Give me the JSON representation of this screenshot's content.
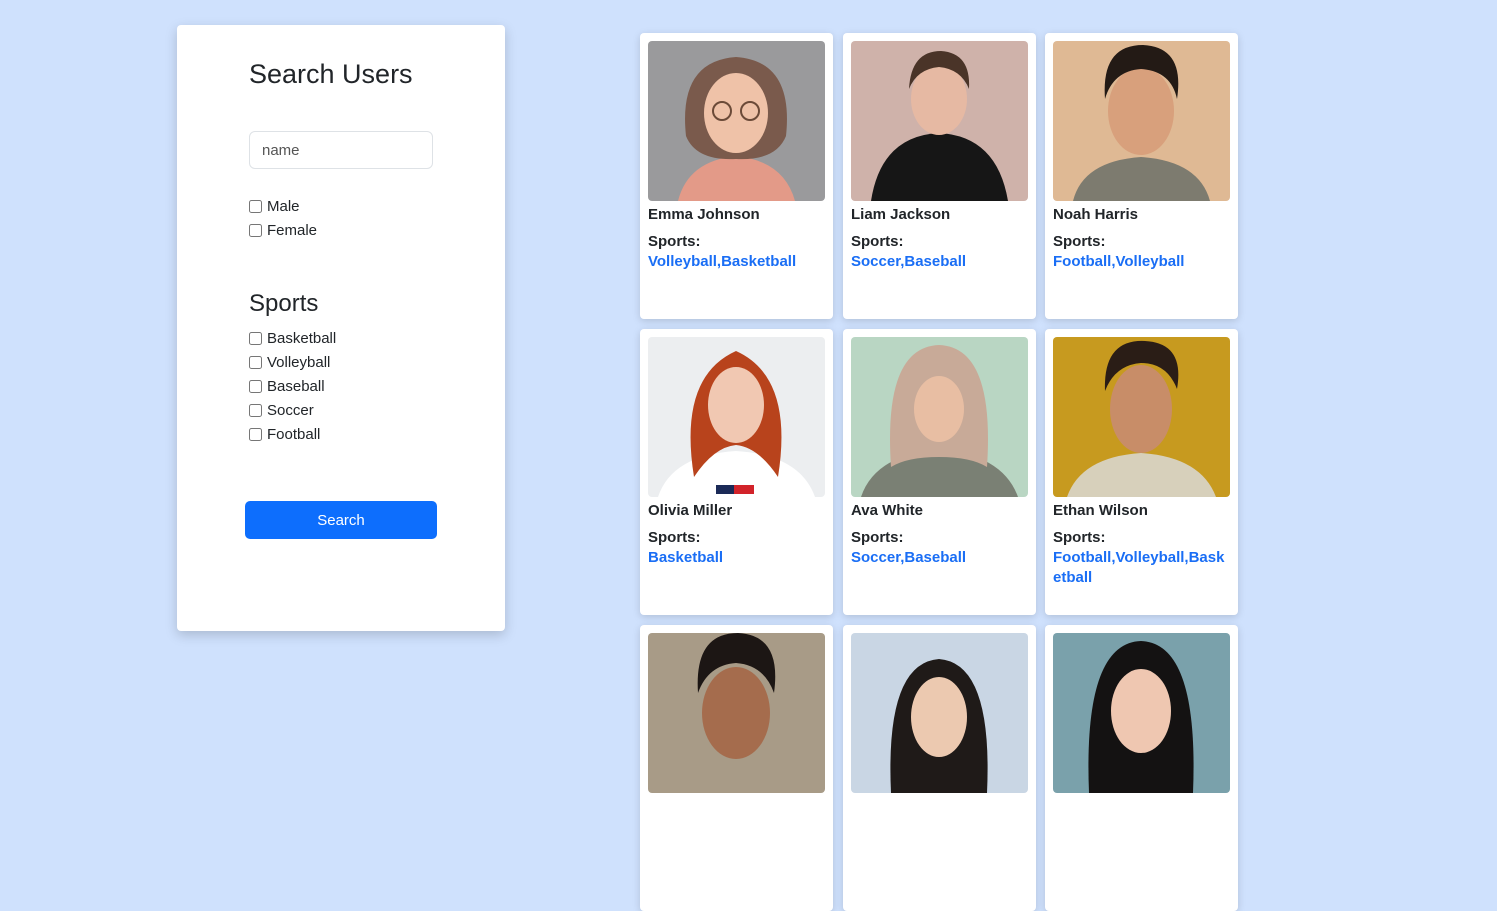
{
  "filter_panel": {
    "title": "Search Users",
    "name_placeholder": "name",
    "gender_options": [
      "Male",
      "Female"
    ],
    "sports_heading": "Sports",
    "sports_options": [
      "Basketball",
      "Volleyball",
      "Baseball",
      "Soccer",
      "Football"
    ],
    "search_button": "Search"
  },
  "cards": [
    {
      "name": "Emma Johnson",
      "sports_label": "Sports:",
      "sports": "Volleyball,Basketball",
      "bg": "#9a9a9c",
      "skin": "#efc2a8",
      "hair": "#7a5a4c",
      "shirt": "#e39a88"
    },
    {
      "name": "Liam Jackson",
      "sports_label": "Sports:",
      "sports": "Soccer,Baseball",
      "bg": "#cfb2aa",
      "skin": "#e6b9a3",
      "hair": "#4a3428",
      "shirt": "#161616"
    },
    {
      "name": "Noah Harris",
      "sports_label": "Sports:",
      "sports": "Football,Volleyball",
      "bg": "#dfb994",
      "skin": "#d8a07c",
      "hair": "#231a15",
      "shirt": "#7d7b6f"
    },
    {
      "name": "Olivia Miller",
      "sports_label": "Sports:",
      "sports": "Basketball",
      "bg": "#eceef0",
      "skin": "#f1c8b2",
      "hair": "#b8431c",
      "shirt": "#ffffff"
    },
    {
      "name": "Ava White",
      "sports_label": "Sports:",
      "sports": "Soccer,Baseball",
      "bg": "#b9d6c3",
      "skin": "#e8bea3",
      "hair": "#c8aa98",
      "shirt": "#7a8074"
    },
    {
      "name": "Ethan Wilson",
      "sports_label": "Sports:",
      "sports": "Football,Volleyball,Basketball",
      "bg": "#c79a1f",
      "skin": "#c88d68",
      "hair": "#2a1d16",
      "shirt": "#d7d0bb"
    },
    {
      "name": "",
      "sports_label": "",
      "sports": "",
      "bg": "#a89b87",
      "skin": "#a56c4d",
      "hair": "#1c1614",
      "shirt": "#6b6b6b"
    },
    {
      "name": "",
      "sports_label": "",
      "sports": "",
      "bg": "#c9d6e4",
      "skin": "#ecc9b0",
      "hair": "#1f1a18",
      "shirt": "#9aa5b1"
    },
    {
      "name": "",
      "sports_label": "",
      "sports": "",
      "bg": "#7aa1ab",
      "skin": "#efc7b1",
      "hair": "#141212",
      "shirt": "#2d3a40"
    }
  ]
}
